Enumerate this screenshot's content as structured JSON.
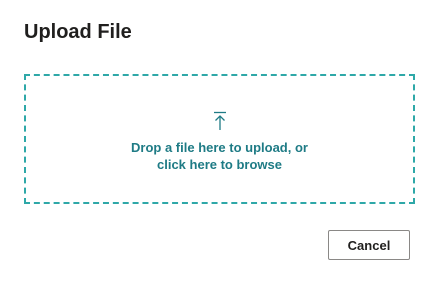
{
  "dialog": {
    "title": "Upload File"
  },
  "dropzone": {
    "line1": "Drop a file here to upload, or",
    "line2": "click here to browse",
    "icon": "upload-arrow-icon",
    "accent_color": "#2ea8a8",
    "text_color": "#1e7b85"
  },
  "actions": {
    "cancel_label": "Cancel"
  }
}
